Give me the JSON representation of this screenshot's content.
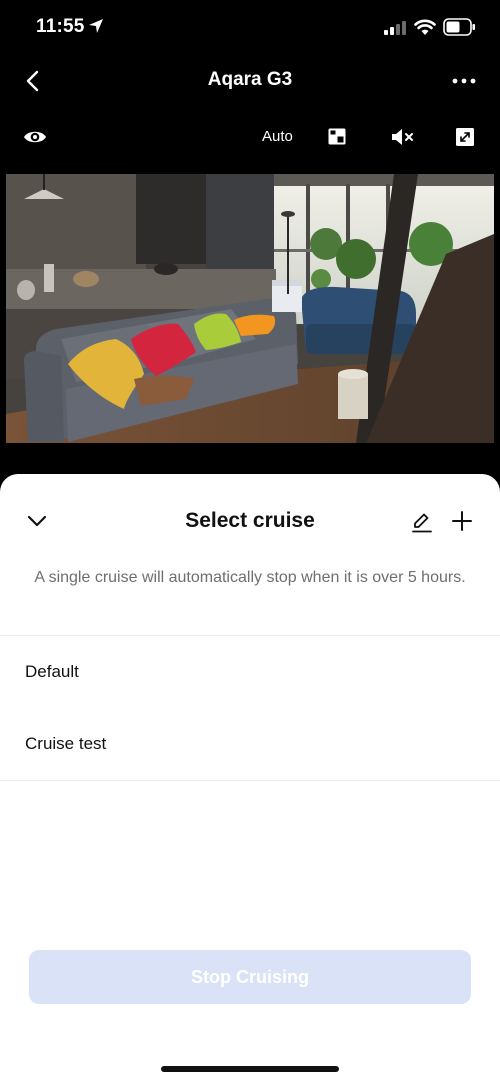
{
  "status_bar": {
    "time": "11:55"
  },
  "nav": {
    "title": "Aqara G3"
  },
  "toolbar": {
    "mode_label": "Auto"
  },
  "sheet": {
    "title": "Select cruise",
    "note": "A single cruise will automatically stop when it is over 5 hours.",
    "items": [
      {
        "label": "Default"
      },
      {
        "label": "Cruise test"
      }
    ],
    "stop_button_label": "Stop Cruising"
  },
  "colors": {
    "background": "#000000",
    "sheet": "#ffffff",
    "button_disabled": "#d9e2f7"
  }
}
